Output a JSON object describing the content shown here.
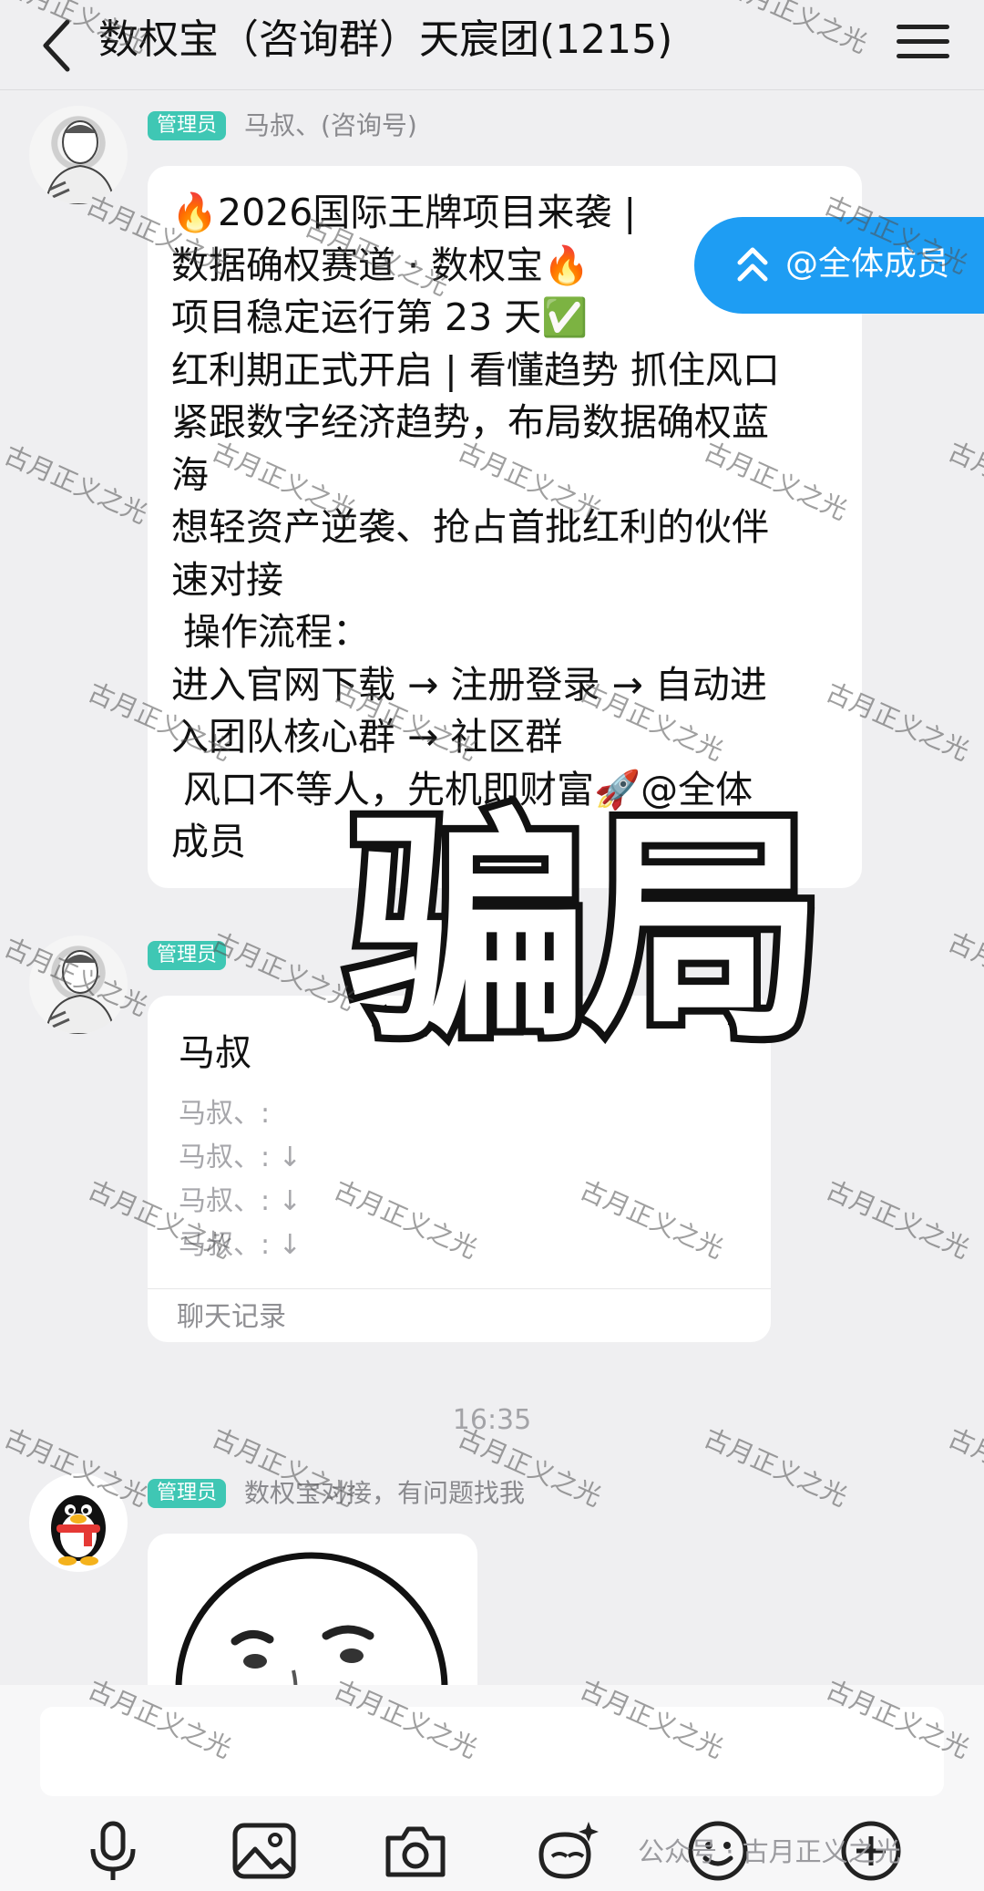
{
  "header": {
    "title": "数权宝（咨询群）天宸团(1215)"
  },
  "messages": {
    "first": {
      "badge": "管理员",
      "sender": "马叔、(咨询号)",
      "lines": [
        "🔥2026国际王牌项目来袭 |",
        "数据确权赛道 · 数权宝🔥",
        "项目稳定运行第 23 天✅",
        "红利期正式开启 | 看懂趋势 抓住风口",
        "紧跟数字经济趋势，布局数据确权蓝",
        "海",
        "想轻资产逆袭、抢占首批红利的伙伴",
        "速对接",
        " 操作流程：",
        "进入官网下载 → 注册登录 → 自动进",
        "入团队核心群 → 社区群",
        " 风口不等人，先机即财富🚀@全体",
        "成员"
      ]
    },
    "second": {
      "badge": "管理员",
      "card_title": "马叔",
      "card_lines": [
        "马叔、:",
        "马叔、: ↓",
        "马叔、: ↓",
        "马叔、: ↓"
      ],
      "card_footer": "聊天记录"
    },
    "timestamp": "16:35",
    "third": {
      "badge": "管理员",
      "sender": "数权宝对接，有问题找我"
    }
  },
  "mention_float": {
    "label": "@全体成员"
  },
  "overlay": {
    "big_word": "骗局",
    "watermark": "古月正义之光"
  },
  "toolbar": {
    "items": [
      "mic-icon",
      "image-icon",
      "camera-icon",
      "red-packet-icon",
      "emoji-icon",
      "plus-icon"
    ]
  },
  "footer_watermark": "公众号 · 古月正义之光"
}
